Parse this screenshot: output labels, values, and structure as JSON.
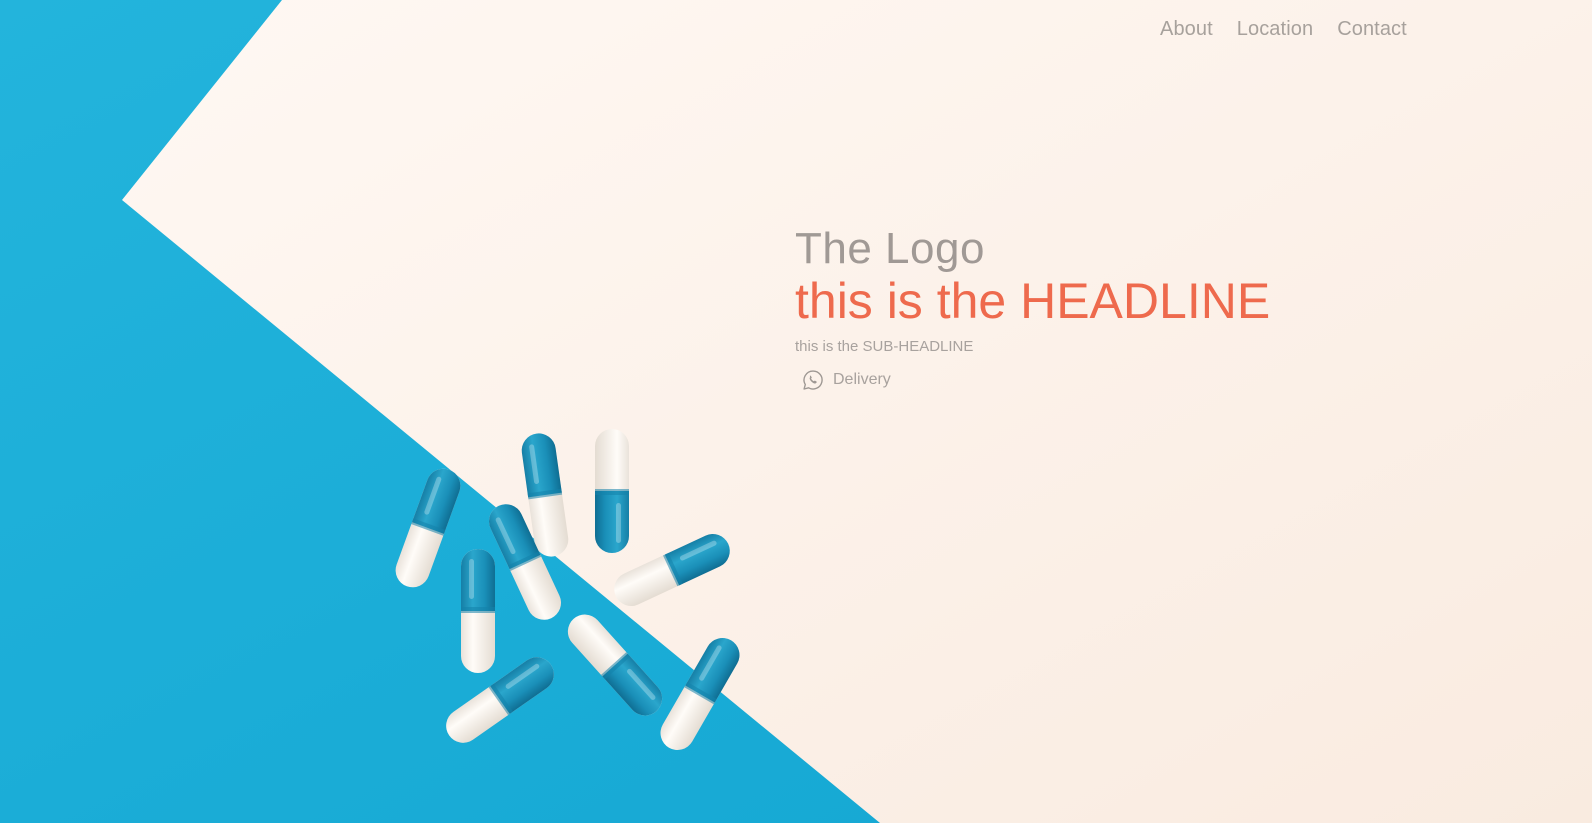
{
  "nav": {
    "items": [
      {
        "label": "About"
      },
      {
        "label": "Location"
      },
      {
        "label": "Contact"
      }
    ]
  },
  "hero": {
    "logo": "The Logo",
    "headline": "this is the HEADLINE",
    "subheadline": "this is the SUB-HEADLINE",
    "delivery_label": "Delivery",
    "delivery_icon": "whatsapp-icon"
  },
  "colors": {
    "cream": "#fdf1e9",
    "blue": "#1fb1da",
    "capsule_blue": "#1e9cc4",
    "capsule_white": "#fbf6f1",
    "headline": "#ee6a4d",
    "muted_text": "#a8a29e"
  }
}
